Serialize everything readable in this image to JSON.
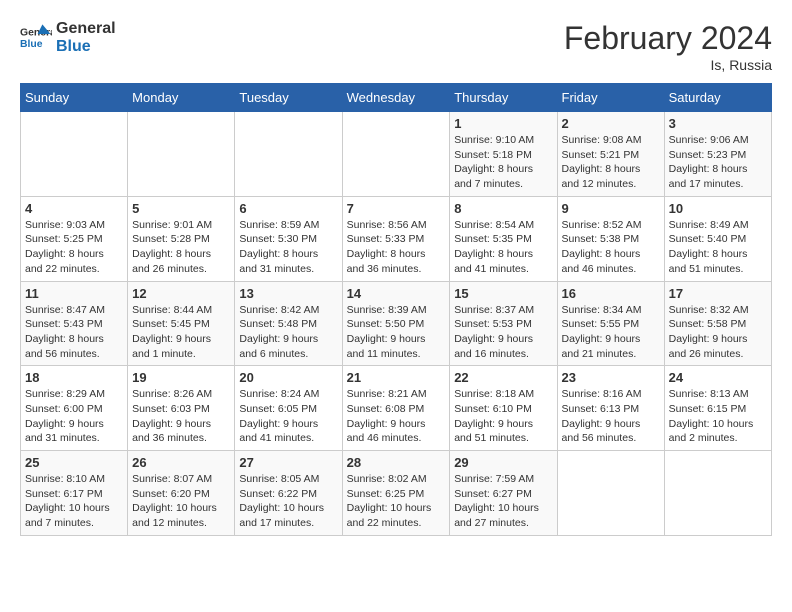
{
  "header": {
    "logo_general": "General",
    "logo_blue": "Blue",
    "month_title": "February 2024",
    "location": "Is, Russia"
  },
  "weekdays": [
    "Sunday",
    "Monday",
    "Tuesday",
    "Wednesday",
    "Thursday",
    "Friday",
    "Saturday"
  ],
  "weeks": [
    [
      {
        "day": "",
        "info": ""
      },
      {
        "day": "",
        "info": ""
      },
      {
        "day": "",
        "info": ""
      },
      {
        "day": "",
        "info": ""
      },
      {
        "day": "1",
        "info": "Sunrise: 9:10 AM\nSunset: 5:18 PM\nDaylight: 8 hours\nand 7 minutes."
      },
      {
        "day": "2",
        "info": "Sunrise: 9:08 AM\nSunset: 5:21 PM\nDaylight: 8 hours\nand 12 minutes."
      },
      {
        "day": "3",
        "info": "Sunrise: 9:06 AM\nSunset: 5:23 PM\nDaylight: 8 hours\nand 17 minutes."
      }
    ],
    [
      {
        "day": "4",
        "info": "Sunrise: 9:03 AM\nSunset: 5:25 PM\nDaylight: 8 hours\nand 22 minutes."
      },
      {
        "day": "5",
        "info": "Sunrise: 9:01 AM\nSunset: 5:28 PM\nDaylight: 8 hours\nand 26 minutes."
      },
      {
        "day": "6",
        "info": "Sunrise: 8:59 AM\nSunset: 5:30 PM\nDaylight: 8 hours\nand 31 minutes."
      },
      {
        "day": "7",
        "info": "Sunrise: 8:56 AM\nSunset: 5:33 PM\nDaylight: 8 hours\nand 36 minutes."
      },
      {
        "day": "8",
        "info": "Sunrise: 8:54 AM\nSunset: 5:35 PM\nDaylight: 8 hours\nand 41 minutes."
      },
      {
        "day": "9",
        "info": "Sunrise: 8:52 AM\nSunset: 5:38 PM\nDaylight: 8 hours\nand 46 minutes."
      },
      {
        "day": "10",
        "info": "Sunrise: 8:49 AM\nSunset: 5:40 PM\nDaylight: 8 hours\nand 51 minutes."
      }
    ],
    [
      {
        "day": "11",
        "info": "Sunrise: 8:47 AM\nSunset: 5:43 PM\nDaylight: 8 hours\nand 56 minutes."
      },
      {
        "day": "12",
        "info": "Sunrise: 8:44 AM\nSunset: 5:45 PM\nDaylight: 9 hours\nand 1 minute."
      },
      {
        "day": "13",
        "info": "Sunrise: 8:42 AM\nSunset: 5:48 PM\nDaylight: 9 hours\nand 6 minutes."
      },
      {
        "day": "14",
        "info": "Sunrise: 8:39 AM\nSunset: 5:50 PM\nDaylight: 9 hours\nand 11 minutes."
      },
      {
        "day": "15",
        "info": "Sunrise: 8:37 AM\nSunset: 5:53 PM\nDaylight: 9 hours\nand 16 minutes."
      },
      {
        "day": "16",
        "info": "Sunrise: 8:34 AM\nSunset: 5:55 PM\nDaylight: 9 hours\nand 21 minutes."
      },
      {
        "day": "17",
        "info": "Sunrise: 8:32 AM\nSunset: 5:58 PM\nDaylight: 9 hours\nand 26 minutes."
      }
    ],
    [
      {
        "day": "18",
        "info": "Sunrise: 8:29 AM\nSunset: 6:00 PM\nDaylight: 9 hours\nand 31 minutes."
      },
      {
        "day": "19",
        "info": "Sunrise: 8:26 AM\nSunset: 6:03 PM\nDaylight: 9 hours\nand 36 minutes."
      },
      {
        "day": "20",
        "info": "Sunrise: 8:24 AM\nSunset: 6:05 PM\nDaylight: 9 hours\nand 41 minutes."
      },
      {
        "day": "21",
        "info": "Sunrise: 8:21 AM\nSunset: 6:08 PM\nDaylight: 9 hours\nand 46 minutes."
      },
      {
        "day": "22",
        "info": "Sunrise: 8:18 AM\nSunset: 6:10 PM\nDaylight: 9 hours\nand 51 minutes."
      },
      {
        "day": "23",
        "info": "Sunrise: 8:16 AM\nSunset: 6:13 PM\nDaylight: 9 hours\nand 56 minutes."
      },
      {
        "day": "24",
        "info": "Sunrise: 8:13 AM\nSunset: 6:15 PM\nDaylight: 10 hours\nand 2 minutes."
      }
    ],
    [
      {
        "day": "25",
        "info": "Sunrise: 8:10 AM\nSunset: 6:17 PM\nDaylight: 10 hours\nand 7 minutes."
      },
      {
        "day": "26",
        "info": "Sunrise: 8:07 AM\nSunset: 6:20 PM\nDaylight: 10 hours\nand 12 minutes."
      },
      {
        "day": "27",
        "info": "Sunrise: 8:05 AM\nSunset: 6:22 PM\nDaylight: 10 hours\nand 17 minutes."
      },
      {
        "day": "28",
        "info": "Sunrise: 8:02 AM\nSunset: 6:25 PM\nDaylight: 10 hours\nand 22 minutes."
      },
      {
        "day": "29",
        "info": "Sunrise: 7:59 AM\nSunset: 6:27 PM\nDaylight: 10 hours\nand 27 minutes."
      },
      {
        "day": "",
        "info": ""
      },
      {
        "day": "",
        "info": ""
      }
    ]
  ]
}
